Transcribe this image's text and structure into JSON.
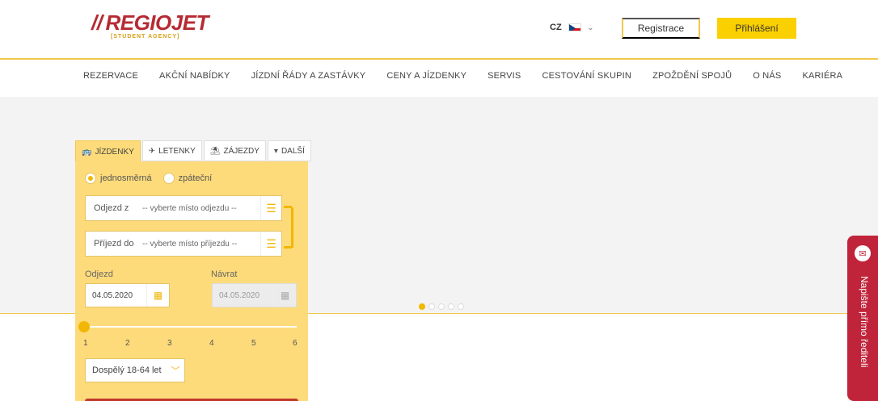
{
  "header": {
    "logo_text": "REGIOJET",
    "logo_sub": "[STUDENT AGENCY]",
    "lang": "CZ",
    "register_label": "Registrace",
    "login_label": "Přihlášení"
  },
  "nav": {
    "items": [
      {
        "label": "Rezervace"
      },
      {
        "label": "Akční nabídky"
      },
      {
        "label": "Jízdní řády a zastávky"
      },
      {
        "label": "Ceny a jízdenky"
      },
      {
        "label": "Servis"
      },
      {
        "label": "Cestování skupin"
      },
      {
        "label": "Zpoždění spojů"
      },
      {
        "label": "O nás"
      },
      {
        "label": "Kariéra"
      }
    ]
  },
  "booking": {
    "tabs": [
      {
        "label": "Jízdenky",
        "icon": "bus-train-icon",
        "glyph": "🚌"
      },
      {
        "label": "Letenky",
        "icon": "plane-icon",
        "glyph": "✈"
      },
      {
        "label": "Zájezdy",
        "icon": "beach-icon",
        "glyph": "⛱"
      },
      {
        "label": "Další",
        "icon": "caret-down-icon",
        "glyph": "▾"
      }
    ],
    "trip_types": [
      {
        "label": "jednosměrná",
        "checked": true
      },
      {
        "label": "zpáteční",
        "checked": false
      }
    ],
    "from": {
      "label": "Odjezd z",
      "value": "-- vyberte místo odjezdu --"
    },
    "to": {
      "label": "Příjezd do",
      "value": "-- vyberte místo příjezdu --"
    },
    "departure": {
      "label": "Odjezd",
      "value": "04.05.2020"
    },
    "return": {
      "label": "Návrat",
      "value": "04.05.2020"
    },
    "passenger_counts": [
      "1",
      "2",
      "3",
      "4",
      "5",
      "6"
    ],
    "passenger_count_selected": 1,
    "passenger_type": "Dospělý 18-64 let"
  },
  "carousel": {
    "count": 5,
    "active": 0
  },
  "feedback": {
    "label": "Napište přímo řediteli"
  },
  "colors": {
    "brand_red": "#b62b33",
    "accent_yellow": "#fbd000",
    "panel_yellow": "#fddb7a",
    "feedback_red": "#c0243a"
  }
}
